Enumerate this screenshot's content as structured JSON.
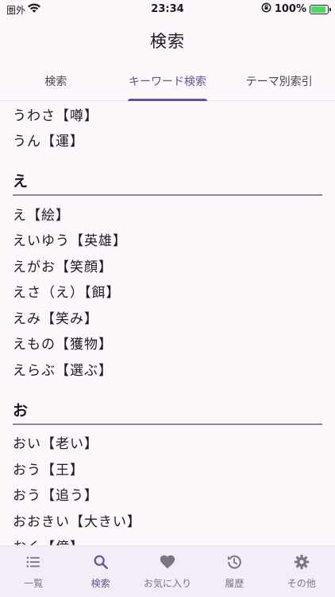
{
  "status_bar": {
    "carrier": "圏外",
    "time": "23:34",
    "battery_pct": "100%"
  },
  "app_bar": {
    "title": "検索"
  },
  "tabs": [
    {
      "label": "検索",
      "active": false
    },
    {
      "label": "キーワード検索",
      "active": true
    },
    {
      "label": "テーマ別索引",
      "active": false
    }
  ],
  "list": {
    "top_items": [
      "うわさ【噂】",
      "うん【運】"
    ],
    "sections": [
      {
        "header": "え",
        "items": [
          "え【絵】",
          "えいゆう【英雄】",
          "えがお【笑顔】",
          "えさ（え）【餌】",
          "えみ【笑み】",
          "えもの【獲物】",
          "えらぶ【選ぶ】"
        ]
      },
      {
        "header": "お",
        "items": [
          "おい【老い】",
          "おう【王】",
          "おう【追う】",
          "おおきい【大きい】",
          "おく【億】"
        ]
      }
    ]
  },
  "bottom_nav": [
    {
      "label": "一覧",
      "icon": "list-icon",
      "active": false
    },
    {
      "label": "検索",
      "icon": "search-icon",
      "active": true
    },
    {
      "label": "お気に入り",
      "icon": "heart-icon",
      "active": false
    },
    {
      "label": "履歴",
      "icon": "history-icon",
      "active": false
    },
    {
      "label": "その他",
      "icon": "gear-icon",
      "active": false
    }
  ]
}
